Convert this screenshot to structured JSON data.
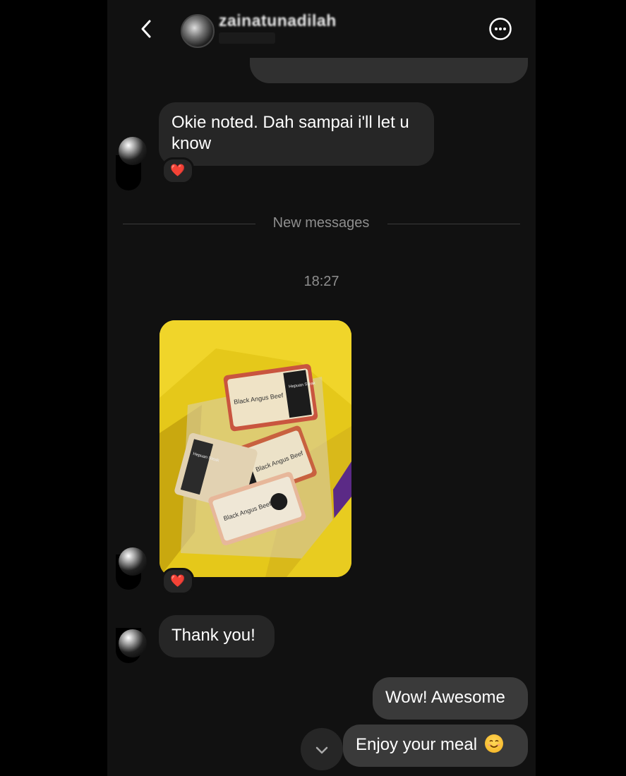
{
  "header": {
    "contact_name": "zainatunadilah",
    "back_icon": "chevron-left-icon",
    "more_icon": "more-horizontal-icon"
  },
  "messages": {
    "incoming_1": "Okie noted. Dah sampai i'll let u know",
    "incoming_1_reaction": "❤️",
    "divider_label": "New messages",
    "timestamp": "18:27",
    "photo_reaction": "❤️",
    "incoming_2": "Thank you!",
    "outgoing_1": "Wow! Awesome",
    "outgoing_2": "Enjoy your meal"
  },
  "photo_labels": {
    "pack_title": "Black Angus Beef",
    "pack_cut": "Hepuan Steak"
  },
  "colors": {
    "background": "#111111",
    "bubble_in": "#262626",
    "bubble_out": "#3a3a3a",
    "muted_text": "#8e8e8e",
    "bag_yellow": "#e5c81a"
  }
}
